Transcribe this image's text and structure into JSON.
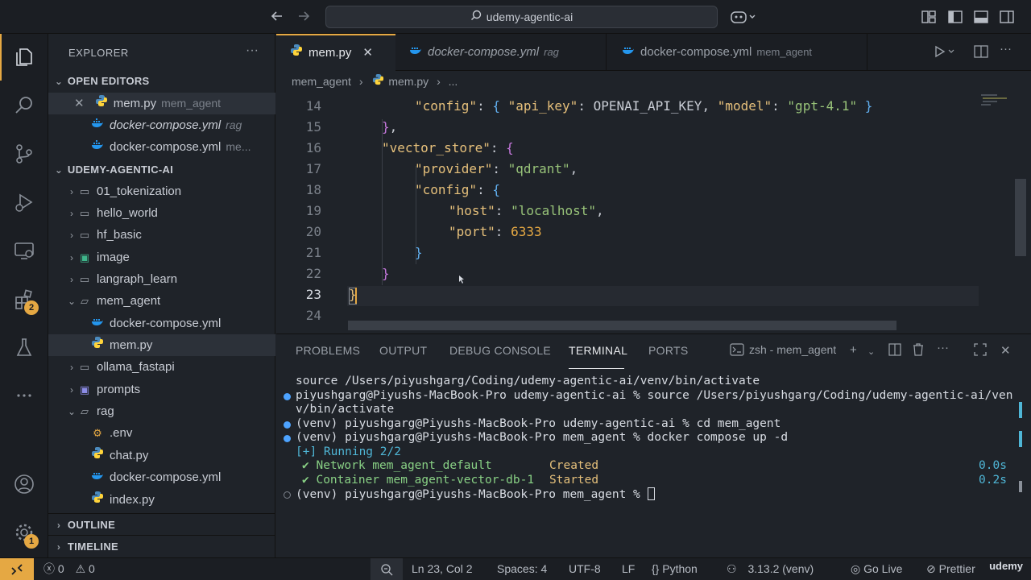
{
  "titlebar": {
    "search_label": "udemy-agentic-ai"
  },
  "activity": {
    "extensions_badge": "2",
    "settings_badge": "1"
  },
  "sidebar": {
    "title": "EXPLORER",
    "open_editors_label": "OPEN EDITORS",
    "open_editors": [
      {
        "name": "mem.py",
        "desc": "mem_agent"
      },
      {
        "name": "docker-compose.yml",
        "desc": "rag"
      },
      {
        "name": "docker-compose.yml",
        "desc": "me..."
      }
    ],
    "workspace_label": "UDEMY-AGENTIC-AI",
    "tree": [
      {
        "name": "01_tokenization"
      },
      {
        "name": "hello_world"
      },
      {
        "name": "hf_basic"
      },
      {
        "name": "image"
      },
      {
        "name": "langraph_learn"
      },
      {
        "name": "mem_agent"
      },
      {
        "name": "docker-compose.yml"
      },
      {
        "name": "mem.py"
      },
      {
        "name": "ollama_fastapi"
      },
      {
        "name": "prompts"
      },
      {
        "name": "rag"
      },
      {
        "name": ".env"
      },
      {
        "name": "chat.py"
      },
      {
        "name": "docker-compose.yml"
      },
      {
        "name": "index.py"
      }
    ],
    "outline_label": "OUTLINE",
    "timeline_label": "TIMELINE"
  },
  "tabs": [
    {
      "name": "mem.py",
      "desc": ""
    },
    {
      "name": "docker-compose.yml",
      "desc": "rag"
    },
    {
      "name": "docker-compose.yml",
      "desc": "mem_agent"
    }
  ],
  "breadcrumb": {
    "folder": "mem_agent",
    "file": "mem.py",
    "more": "..."
  },
  "editor": {
    "line_numbers": [
      "14",
      "15",
      "16",
      "17",
      "18",
      "19",
      "20",
      "21",
      "22",
      "23",
      "24"
    ],
    "code": {
      "l14_key1": "\"config\"",
      "l14_key2": "\"api_key\"",
      "l14_val2": "OPENAI_API_KEY,",
      "l14_key3": "\"model\"",
      "l14_val3": "\"gpt-4.1\"",
      "l16_key": "\"vector_store\"",
      "l17_key": "\"provider\"",
      "l17_val": "\"qdrant\"",
      "l18_key": "\"config\"",
      "l19_key": "\"host\"",
      "l19_val": "\"localhost\"",
      "l20_key": "\"port\"",
      "l20_val": "6333"
    }
  },
  "panel": {
    "tabs": [
      "PROBLEMS",
      "OUTPUT",
      "DEBUG CONSOLE",
      "TERMINAL",
      "PORTS"
    ],
    "terminal_name": "zsh - mem_agent",
    "terminal": {
      "l1": "source /Users/piyushgarg/Coding/udemy-agentic-ai/venv/bin/activate",
      "l2": "piyushgarg@Piyushs-MacBook-Pro udemy-agentic-ai % source /Users/piyushgarg/Coding/udemy-agentic-ai/ven",
      "l3": "v/bin/activate",
      "l4": "(venv) piyushgarg@Piyushs-MacBook-Pro udemy-agentic-ai % cd mem_agent",
      "l5": "(venv) piyushgarg@Piyushs-MacBook-Pro mem_agent % docker compose up -d",
      "l6": "[+] Running 2/2",
      "l7_name": "✔ Network mem_agent_default",
      "l7_status": "Created",
      "l7_time": "0.0s",
      "l8_name": "✔ Container mem_agent-vector-db-1",
      "l8_status": "Started",
      "l8_time": "0.2s",
      "l9": "(venv) piyushgarg@Piyushs-MacBook-Pro mem_agent % "
    }
  },
  "statusbar": {
    "errors": "0",
    "warnings": "0",
    "position": "Ln 23, Col 2",
    "spaces": "Spaces: 4",
    "encoding": "UTF-8",
    "eol": "LF",
    "language": "Python",
    "interpreter": "3.13.2 (venv)",
    "golive": "Go Live",
    "prettier": "Prettier",
    "watermark": "udemy"
  }
}
